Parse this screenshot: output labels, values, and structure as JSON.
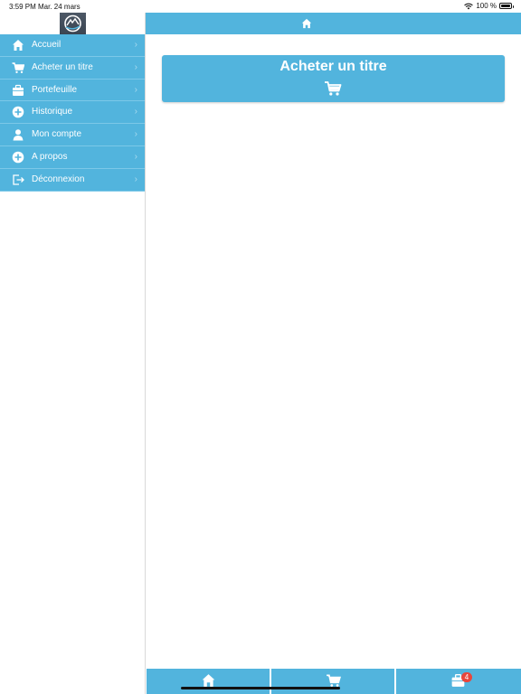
{
  "status_bar": {
    "time": "3:59 PM",
    "date": "Mar. 24 mars",
    "battery_text": "100 %",
    "battery_level": 1.0
  },
  "sidebar": {
    "logo_icon": "app-logo",
    "items": [
      {
        "label": "Accueil",
        "icon": "home-icon"
      },
      {
        "label": "Acheter un titre",
        "icon": "cart-icon"
      },
      {
        "label": "Portefeuille",
        "icon": "wallet-icon"
      },
      {
        "label": "Historique",
        "icon": "plus-circle-icon"
      },
      {
        "label": "Mon compte",
        "icon": "user-icon"
      },
      {
        "label": "A propos",
        "icon": "plus-circle-icon"
      },
      {
        "label": "Déconnexion",
        "icon": "logout-icon"
      }
    ]
  },
  "header": {
    "icon": "home-icon"
  },
  "main": {
    "buy_card": {
      "title": "Acheter un titre",
      "icon": "cart-icon"
    }
  },
  "tab_bar": {
    "tabs": [
      {
        "icon": "home-icon"
      },
      {
        "icon": "cart-icon"
      },
      {
        "icon": "wallet-icon",
        "badge": "4"
      }
    ]
  },
  "colors": {
    "accent": "#52b4dd",
    "badge": "#e8463c",
    "text_on_accent": "#ffffff"
  }
}
